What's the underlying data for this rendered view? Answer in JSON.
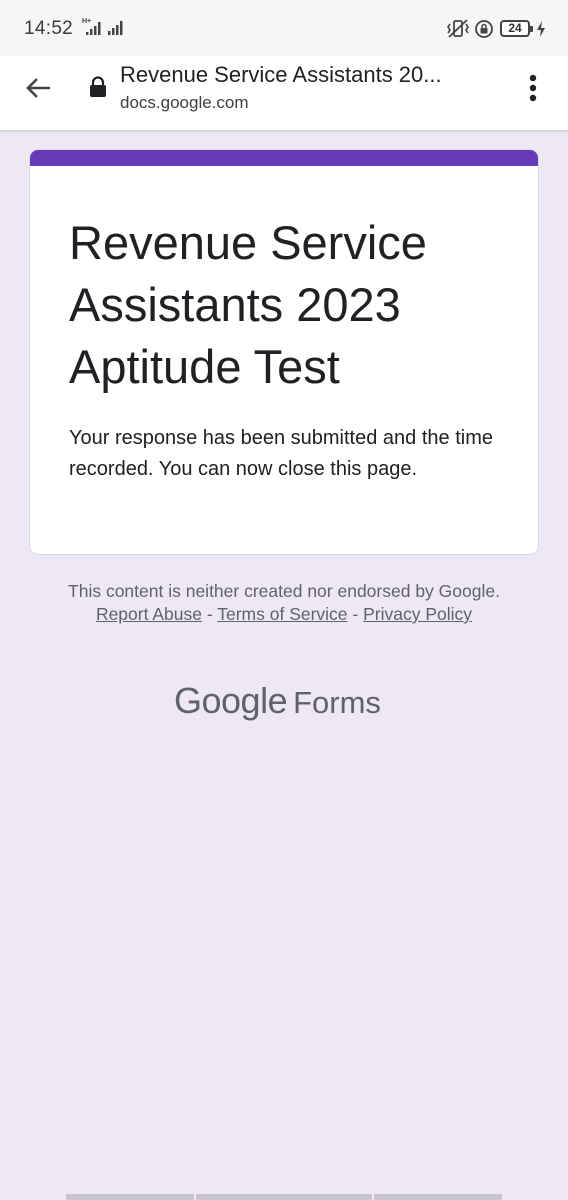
{
  "status_bar": {
    "time": "14:52",
    "network_label": "H+",
    "battery_level": "24"
  },
  "toolbar": {
    "page_title": "Revenue Service Assistants 20...",
    "url": "docs.google.com",
    "icons": [
      "back-arrow-icon",
      "lock-icon",
      "more-vert-icon"
    ]
  },
  "card": {
    "accent_color": "#673ab7",
    "title": "Revenue Service Assistants 2023 Aptitude Test",
    "message": "Your response has been submitted and the time recorded. You can now close this page."
  },
  "footer": {
    "disclaimer": "This content is neither created nor endorsed by Google.",
    "report_abuse": "Report Abuse",
    "separator": "-",
    "terms_of_service": "Terms of Service",
    "privacy_policy": "Privacy Policy",
    "logo_google": "Google",
    "logo_forms": "Forms"
  },
  "colors": {
    "page_background": "#ede7f6",
    "text_primary": "#202124",
    "text_secondary": "#5f6368"
  }
}
